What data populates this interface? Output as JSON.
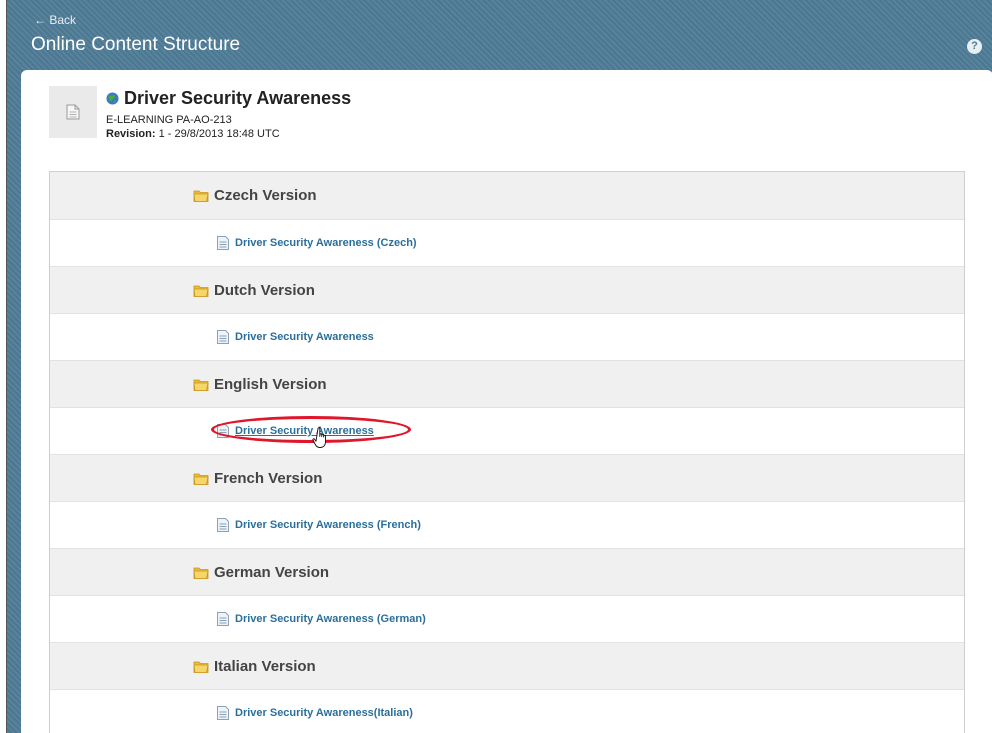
{
  "header": {
    "back_label": "← Back",
    "title": "Online Content Structure",
    "help_icon": "question-icon",
    "help_glyph": "?"
  },
  "course": {
    "title": "Driver Security Awareness",
    "globe_icon": "globe-icon",
    "code": "E-LEARNING PA-AO-213",
    "revision_label": "Revision:",
    "revision_value": "1 - 29/8/2013 18:48 UTC"
  },
  "tree": {
    "folders": [
      {
        "label": "Czech Version",
        "item": "Driver Security Awareness (Czech)"
      },
      {
        "label": "Dutch Version",
        "item": "Driver Security Awareness"
      },
      {
        "label": "English Version",
        "item": "Driver Security Awareness"
      },
      {
        "label": "French Version",
        "item": "Driver Security Awareness (French)"
      },
      {
        "label": "German Version",
        "item": "Driver Security Awareness (German)"
      },
      {
        "label": "Italian Version",
        "item": "Driver Security Awareness(Italian)"
      }
    ]
  },
  "colors": {
    "header_bg": "#4f7c97",
    "link": "#2a6f9b",
    "highlight": "#e0162b",
    "folder": "#f2c94c"
  }
}
